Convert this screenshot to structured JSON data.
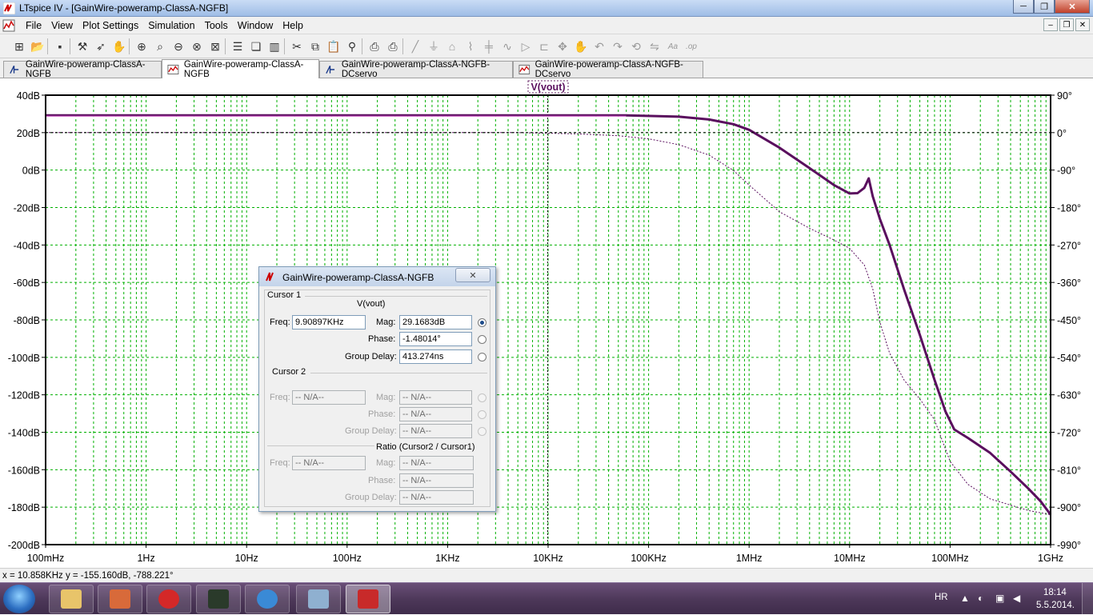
{
  "window": {
    "title": "LTspice IV - [GainWire-poweramp-ClassA-NGFB]",
    "minimize_glyph": "─",
    "maximize_glyph": "❐",
    "close_glyph": "✕"
  },
  "menu": {
    "items": [
      "File",
      "View",
      "Plot Settings",
      "Simulation",
      "Tools",
      "Window",
      "Help"
    ],
    "mdi_buttons": [
      "–",
      "❐",
      "✕"
    ]
  },
  "toolbar": {
    "icons": [
      "schematic-icon",
      "open-icon",
      "save-icon",
      "control-panel-icon",
      "run-icon",
      "pan-icon",
      "zoom-in-icon",
      "zoom-area-icon",
      "zoom-out-icon",
      "zoom-fit-icon",
      "autorange-icon",
      "tile-horizontal-icon",
      "cascade-icon",
      "tile-vertical-icon",
      "cut-icon",
      "copy-icon",
      "paste-icon",
      "find-icon",
      "print-preview-icon",
      "print-icon",
      "wire-icon",
      "ground-icon",
      "label-icon",
      "resistor-icon",
      "capacitor-icon",
      "inductor-icon",
      "diode-icon",
      "component-icon",
      "move-icon",
      "drag-icon",
      "undo-icon",
      "redo-icon",
      "rotate-icon",
      "mirror-icon",
      "text-icon",
      "spice-directive-icon"
    ]
  },
  "tabs": [
    {
      "label": "GainWire-poweramp-ClassA-NGFB",
      "kind": "schematic",
      "active": false
    },
    {
      "label": "GainWire-poweramp-ClassA-NGFB",
      "kind": "waveform",
      "active": true
    },
    {
      "label": "GainWire-poweramp-ClassA-NGFB-DCservo",
      "kind": "schematic",
      "active": false
    },
    {
      "label": "GainWire-poweramp-ClassA-NGFB-DCservo",
      "kind": "waveform",
      "active": false
    }
  ],
  "colors": {
    "trace": "#5a0f5e",
    "grid": "#00b000",
    "frame": "#000000"
  },
  "chart_data": {
    "type": "line",
    "title": "V(vout)",
    "xscale": "log",
    "xlim": [
      0.1,
      1000000000
    ],
    "x_ticks": [
      {
        "value": 0.1,
        "label": "100mHz"
      },
      {
        "value": 1,
        "label": "1Hz"
      },
      {
        "value": 10,
        "label": "10Hz"
      },
      {
        "value": 100,
        "label": "100Hz"
      },
      {
        "value": 1000,
        "label": "1KHz"
      },
      {
        "value": 10000,
        "label": "10KHz"
      },
      {
        "value": 100000,
        "label": "100KHz"
      },
      {
        "value": 1000000,
        "label": "1MHz"
      },
      {
        "value": 10000000,
        "label": "10MHz"
      },
      {
        "value": 100000000,
        "label": "100MHz"
      },
      {
        "value": 1000000000,
        "label": "1GHz"
      }
    ],
    "ylim": [
      -200,
      40
    ],
    "y_ticks": [
      {
        "value": 40,
        "label": "40dB"
      },
      {
        "value": 20,
        "label": "20dB"
      },
      {
        "value": 0,
        "label": "0dB"
      },
      {
        "value": -20,
        "label": "-20dB"
      },
      {
        "value": -40,
        "label": "-40dB"
      },
      {
        "value": -60,
        "label": "-60dB"
      },
      {
        "value": -80,
        "label": "-80dB"
      },
      {
        "value": -100,
        "label": "-100dB"
      },
      {
        "value": -120,
        "label": "-120dB"
      },
      {
        "value": -140,
        "label": "-140dB"
      },
      {
        "value": -160,
        "label": "-160dB"
      },
      {
        "value": -180,
        "label": "-180dB"
      },
      {
        "value": -200,
        "label": "-200dB"
      }
    ],
    "y2lim": [
      -990,
      90
    ],
    "y2_ticks": [
      {
        "value": 90,
        "label": "90°"
      },
      {
        "value": 0,
        "label": "0°"
      },
      {
        "value": -90,
        "label": "-90°"
      },
      {
        "value": -180,
        "label": "-180°"
      },
      {
        "value": -270,
        "label": "-270°"
      },
      {
        "value": -360,
        "label": "-360°"
      },
      {
        "value": -450,
        "label": "-450°"
      },
      {
        "value": -540,
        "label": "-540°"
      },
      {
        "value": -630,
        "label": "-630°"
      },
      {
        "value": -720,
        "label": "-720°"
      },
      {
        "value": -810,
        "label": "-810°"
      },
      {
        "value": -900,
        "label": "-900°"
      },
      {
        "value": -990,
        "label": "-990°"
      }
    ],
    "grid": true,
    "series": [
      {
        "name": "V(vout)",
        "quantity": "magnitude",
        "axis": "left",
        "x": [
          0.1,
          1,
          10,
          100,
          1000,
          10000,
          60000,
          200000,
          400000,
          700000,
          1000000,
          2000000,
          4000000,
          7000000,
          10000000,
          12000000,
          14000000,
          15500000,
          17000000,
          20000000,
          25000000,
          35000000,
          50000000,
          70000000,
          90000000,
          110000000,
          150000000,
          250000000,
          400000000,
          600000000,
          800000000,
          1000000000
        ],
        "y": [
          29.2,
          29.2,
          29.2,
          29.2,
          29.2,
          29.2,
          29.2,
          28.5,
          27,
          24.5,
          21.5,
          12,
          1,
          -8,
          -12.5,
          -12.3,
          -9.5,
          -4.4,
          -14,
          -26,
          -40,
          -64,
          -88,
          -112,
          -129,
          -138.5,
          -143,
          -151,
          -161,
          -170,
          -177,
          -184
        ]
      },
      {
        "name": "V(vout) phase",
        "quantity": "phase",
        "axis": "right",
        "x": [
          0.1,
          1,
          10,
          100,
          1000,
          5000,
          10000,
          20000,
          50000,
          100000,
          200000,
          400000,
          700000,
          1000000,
          2000000,
          4000000,
          7000000,
          10000000,
          14000000,
          17000000,
          20000000,
          25000000,
          35000000,
          50000000,
          70000000,
          100000000,
          150000000,
          250000000,
          400000000,
          600000000,
          1000000000
        ],
        "y": [
          0,
          0,
          0,
          0,
          0,
          0,
          -1.48,
          -3,
          -7.5,
          -15,
          -29,
          -54,
          -91,
          -126,
          -190,
          -230,
          -258,
          -278,
          -318,
          -375,
          -455,
          -530,
          -595,
          -640,
          -690,
          -790,
          -845,
          -880,
          -895,
          -908,
          -918
        ]
      },
      {
        "name": "reference",
        "quantity": "reference",
        "axis": "right",
        "x": [
          0.1,
          1000000000
        ],
        "y": [
          0,
          0
        ]
      }
    ]
  },
  "cursor_dialog": {
    "title": "GainWire-poweramp-ClassA-NGFB",
    "close_glyph": "✕",
    "cursor1": {
      "group": "Cursor 1",
      "trace": "V(vout)",
      "freq_label": "Freq:",
      "freq": "9.90897KHz",
      "mag_label": "Mag:",
      "mag": "29.1683dB",
      "phase_label": "Phase:",
      "phase": "-1.48014°",
      "gd_label": "Group Delay:",
      "gd": "413.274ns"
    },
    "cursor2": {
      "group": "Cursor 2",
      "freq_label": "Freq:",
      "freq": "-- N/A--",
      "mag_label": "Mag:",
      "mag": "-- N/A--",
      "phase_label": "Phase:",
      "phase": "-- N/A--",
      "gd_label": "Group Delay:",
      "gd": "-- N/A--"
    },
    "ratio": {
      "group": "Ratio (Cursor2 / Cursor1)",
      "freq_label": "Freq:",
      "freq": "-- N/A--",
      "mag_label": "Mag:",
      "mag": "-- N/A--",
      "phase_label": "Phase:",
      "phase": "-- N/A--",
      "gd_label": "Group Delay:",
      "gd": "-- N/A--"
    }
  },
  "status": {
    "text": "x = 10.858KHz   y = -155.160dB, -788.221°"
  },
  "taskbar": {
    "apps": [
      "explorer-app-icon",
      "package-app-icon",
      "antivirus-app-icon",
      "ltspice-wave-app-icon",
      "internet-explorer-app-icon",
      "control-panel-app-icon",
      "ltspice-app-icon"
    ],
    "language": "HR",
    "time": "18:14",
    "date": "5.5.2014."
  }
}
